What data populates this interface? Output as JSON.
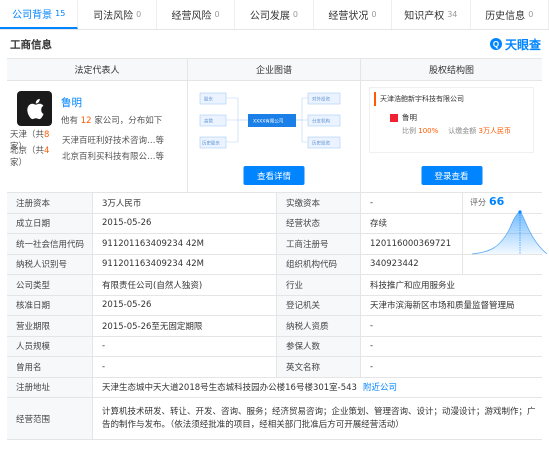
{
  "tabs": [
    {
      "label": "公司背景",
      "count": "15",
      "active": true
    },
    {
      "label": "司法风险",
      "count": "0"
    },
    {
      "label": "经营风险",
      "count": "0"
    },
    {
      "label": "公司发展",
      "count": "0"
    },
    {
      "label": "经营状况",
      "count": "0"
    },
    {
      "label": "知识产权",
      "count": "34"
    },
    {
      "label": "历史信息",
      "count": "0"
    }
  ],
  "section": {
    "title": "工商信息",
    "brand": "天眼查",
    "brand_mark": "Q"
  },
  "legal_rep": {
    "header": "法定代表人",
    "name": "鲁明",
    "summary_prefix": "他有",
    "summary_count": "12",
    "summary_suffix": "家公司，分布如下",
    "locations": [
      {
        "city": "天津",
        "count": "8",
        "company": "天津百旺利好技术咨询…等"
      },
      {
        "city": "北京",
        "count": "4",
        "company": "北京百利买科技有限公…等"
      }
    ]
  },
  "graph": {
    "header": "企业图谱",
    "button": "查看详情",
    "center": "XXXX有限公司",
    "left_nodes": [
      "股东",
      "高管",
      "历史股东"
    ],
    "right_nodes": [
      "对外投资",
      "分支机构",
      "历史投资"
    ]
  },
  "equity": {
    "header": "股权结构图",
    "button": "登录查看",
    "company": "天津浩鲍新宇科技有限公司",
    "holder": "鲁明",
    "ratio_label": "比例",
    "ratio": "100%",
    "capital_label": "认缴金额",
    "capital": "3万人民币"
  },
  "score": {
    "label": "评分",
    "value": "66",
    "color": "#0084ff"
  },
  "fields": {
    "reg_capital": {
      "label": "注册资本",
      "value": "3万人民币"
    },
    "paid_capital": {
      "label": "实缴资本",
      "value": "-"
    },
    "established": {
      "label": "成立日期",
      "value": "2015-05-26"
    },
    "status": {
      "label": "经营状态",
      "value": "存续"
    },
    "credit_code": {
      "label": "统一社会信用代码",
      "value": "911201163409234 42M"
    },
    "reg_no": {
      "label": "工商注册号",
      "value": "120116000369721"
    },
    "taxpayer_id": {
      "label": "纳税人识别号",
      "value": "911201163409234 42M"
    },
    "org_code": {
      "label": "组织机构代码",
      "value": "340923442"
    },
    "company_type": {
      "label": "公司类型",
      "value": "有限责任公司(自然人独资)"
    },
    "industry": {
      "label": "行业",
      "value": "科技推广和应用服务业"
    },
    "approval_date": {
      "label": "核准日期",
      "value": "2015-05-26"
    },
    "reg_authority": {
      "label": "登记机关",
      "value": "天津市滨海新区市场和质量监督管理局"
    },
    "term": {
      "label": "营业期限",
      "value": "2015-05-26至无固定期限"
    },
    "taxpayer_qual": {
      "label": "纳税人资质",
      "value": "-"
    },
    "staff_size": {
      "label": "人员规模",
      "value": "-"
    },
    "insured": {
      "label": "参保人数",
      "value": "-"
    },
    "former_name": {
      "label": "曾用名",
      "value": "-"
    },
    "english_name": {
      "label": "英文名称",
      "value": "-"
    },
    "address": {
      "label": "注册地址",
      "value": "天津生态城中天大道2018号生态城科技园办公楼16号楼301室-543",
      "link": "附近公司"
    },
    "scope": {
      "label": "经营范围",
      "value": "计算机技术研发、转让、开发、咨询、服务；经济贸易咨询；企业策划、管理咨询、设计；动漫设计；游戏制作；广告的制作与发布。（依法须经批准的项目，经相关部门批准后方可开展经营活动）"
    }
  }
}
